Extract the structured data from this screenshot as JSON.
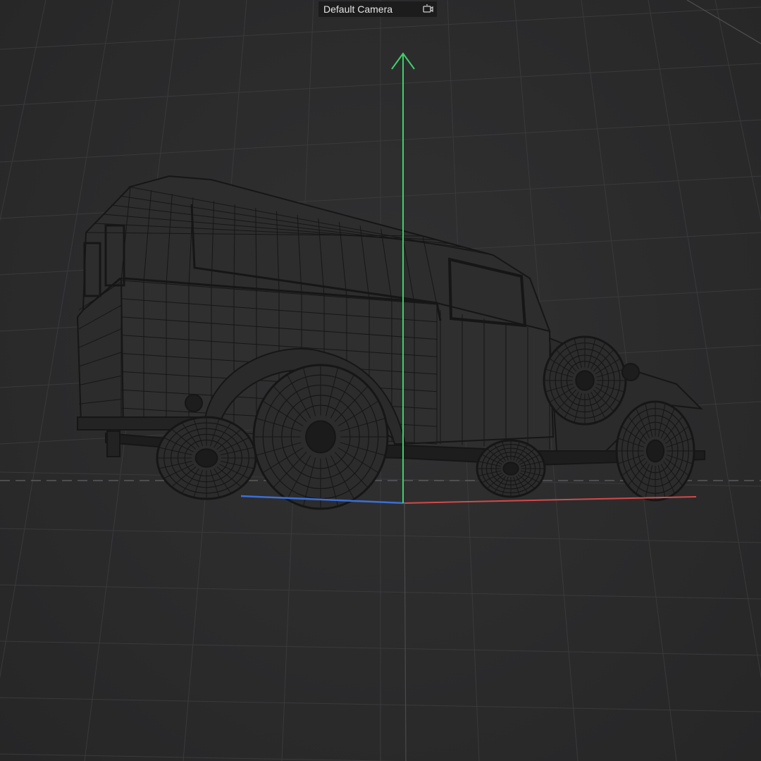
{
  "viewport": {
    "camera_label": "Default Camera",
    "camera_icon": "camera-switch-icon",
    "colors": {
      "background": "#2b2b2c",
      "grid": "#3a3a3c",
      "wire": "#161616",
      "axis_y": "#3fd06a",
      "axis_x": "#d24a4a",
      "axis_z": "#3b6fd8",
      "horizon": "#5a5a5c"
    }
  },
  "model": {
    "name_icon": "delivery-van-wireframe"
  }
}
